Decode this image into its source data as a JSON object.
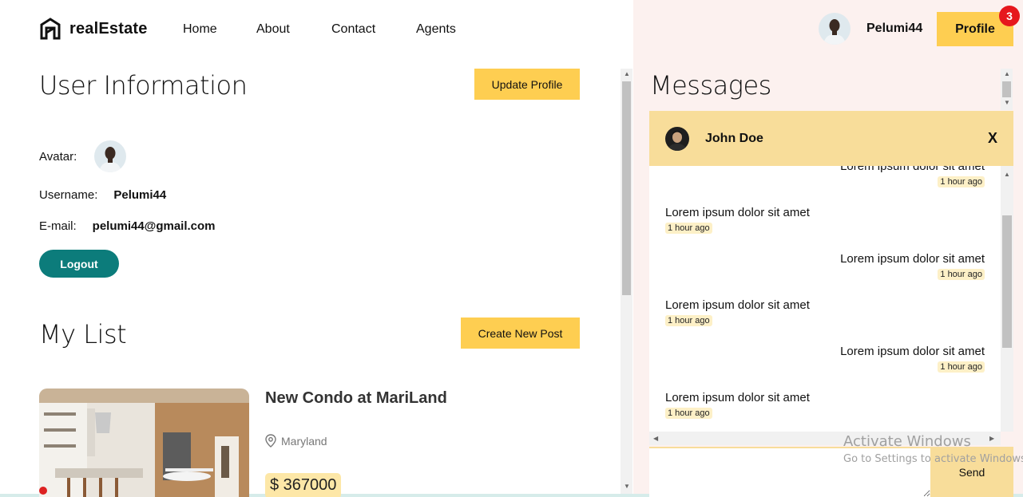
{
  "nav": {
    "brand": "realEstate",
    "links": [
      "Home",
      "About",
      "Contact",
      "Agents"
    ],
    "username": "Pelumi44",
    "profile_label": "Profile",
    "notification_count": "3"
  },
  "user_info": {
    "title": "User Information",
    "update_label": "Update Profile",
    "avatar_label": "Avatar:",
    "username_label": "Username:",
    "username_value": "Pelumi44",
    "email_label": "E-mail:",
    "email_value": "pelumi44@gmail.com",
    "logout_label": "Logout"
  },
  "my_list": {
    "title": "My List",
    "create_label": "Create New Post",
    "post": {
      "title": "New Condo at MariLand",
      "location": "Maryland",
      "price": "$ 367000"
    }
  },
  "messages": {
    "title": "Messages",
    "chat": {
      "name": "John Doe",
      "close": "X",
      "items": [
        {
          "side": "right",
          "text": "Lorem ipsum dolor sit amet",
          "time": "1 hour ago"
        },
        {
          "side": "left",
          "text": "Lorem ipsum dolor sit amet",
          "time": "1 hour ago"
        },
        {
          "side": "right",
          "text": "Lorem ipsum dolor sit amet",
          "time": "1 hour ago"
        },
        {
          "side": "left",
          "text": "Lorem ipsum dolor sit amet",
          "time": "1 hour ago"
        },
        {
          "side": "right",
          "text": "Lorem ipsum dolor sit amet",
          "time": "1 hour ago"
        },
        {
          "side": "left",
          "text": "Lorem ipsum dolor sit amet",
          "time": "1 hour ago"
        }
      ],
      "send_label": "Send"
    }
  },
  "watermark": {
    "line1": "Activate Windows",
    "line2": "Go to Settings to activate Windows."
  },
  "colors": {
    "accent": "#fece51",
    "teal": "#0c7c7b",
    "chat_header": "#f8dd9a",
    "right_bg": "#fcf1ef",
    "badge": "#e6171d"
  },
  "icons": [
    "logo-icon",
    "location-pin-icon",
    "avatar"
  ]
}
